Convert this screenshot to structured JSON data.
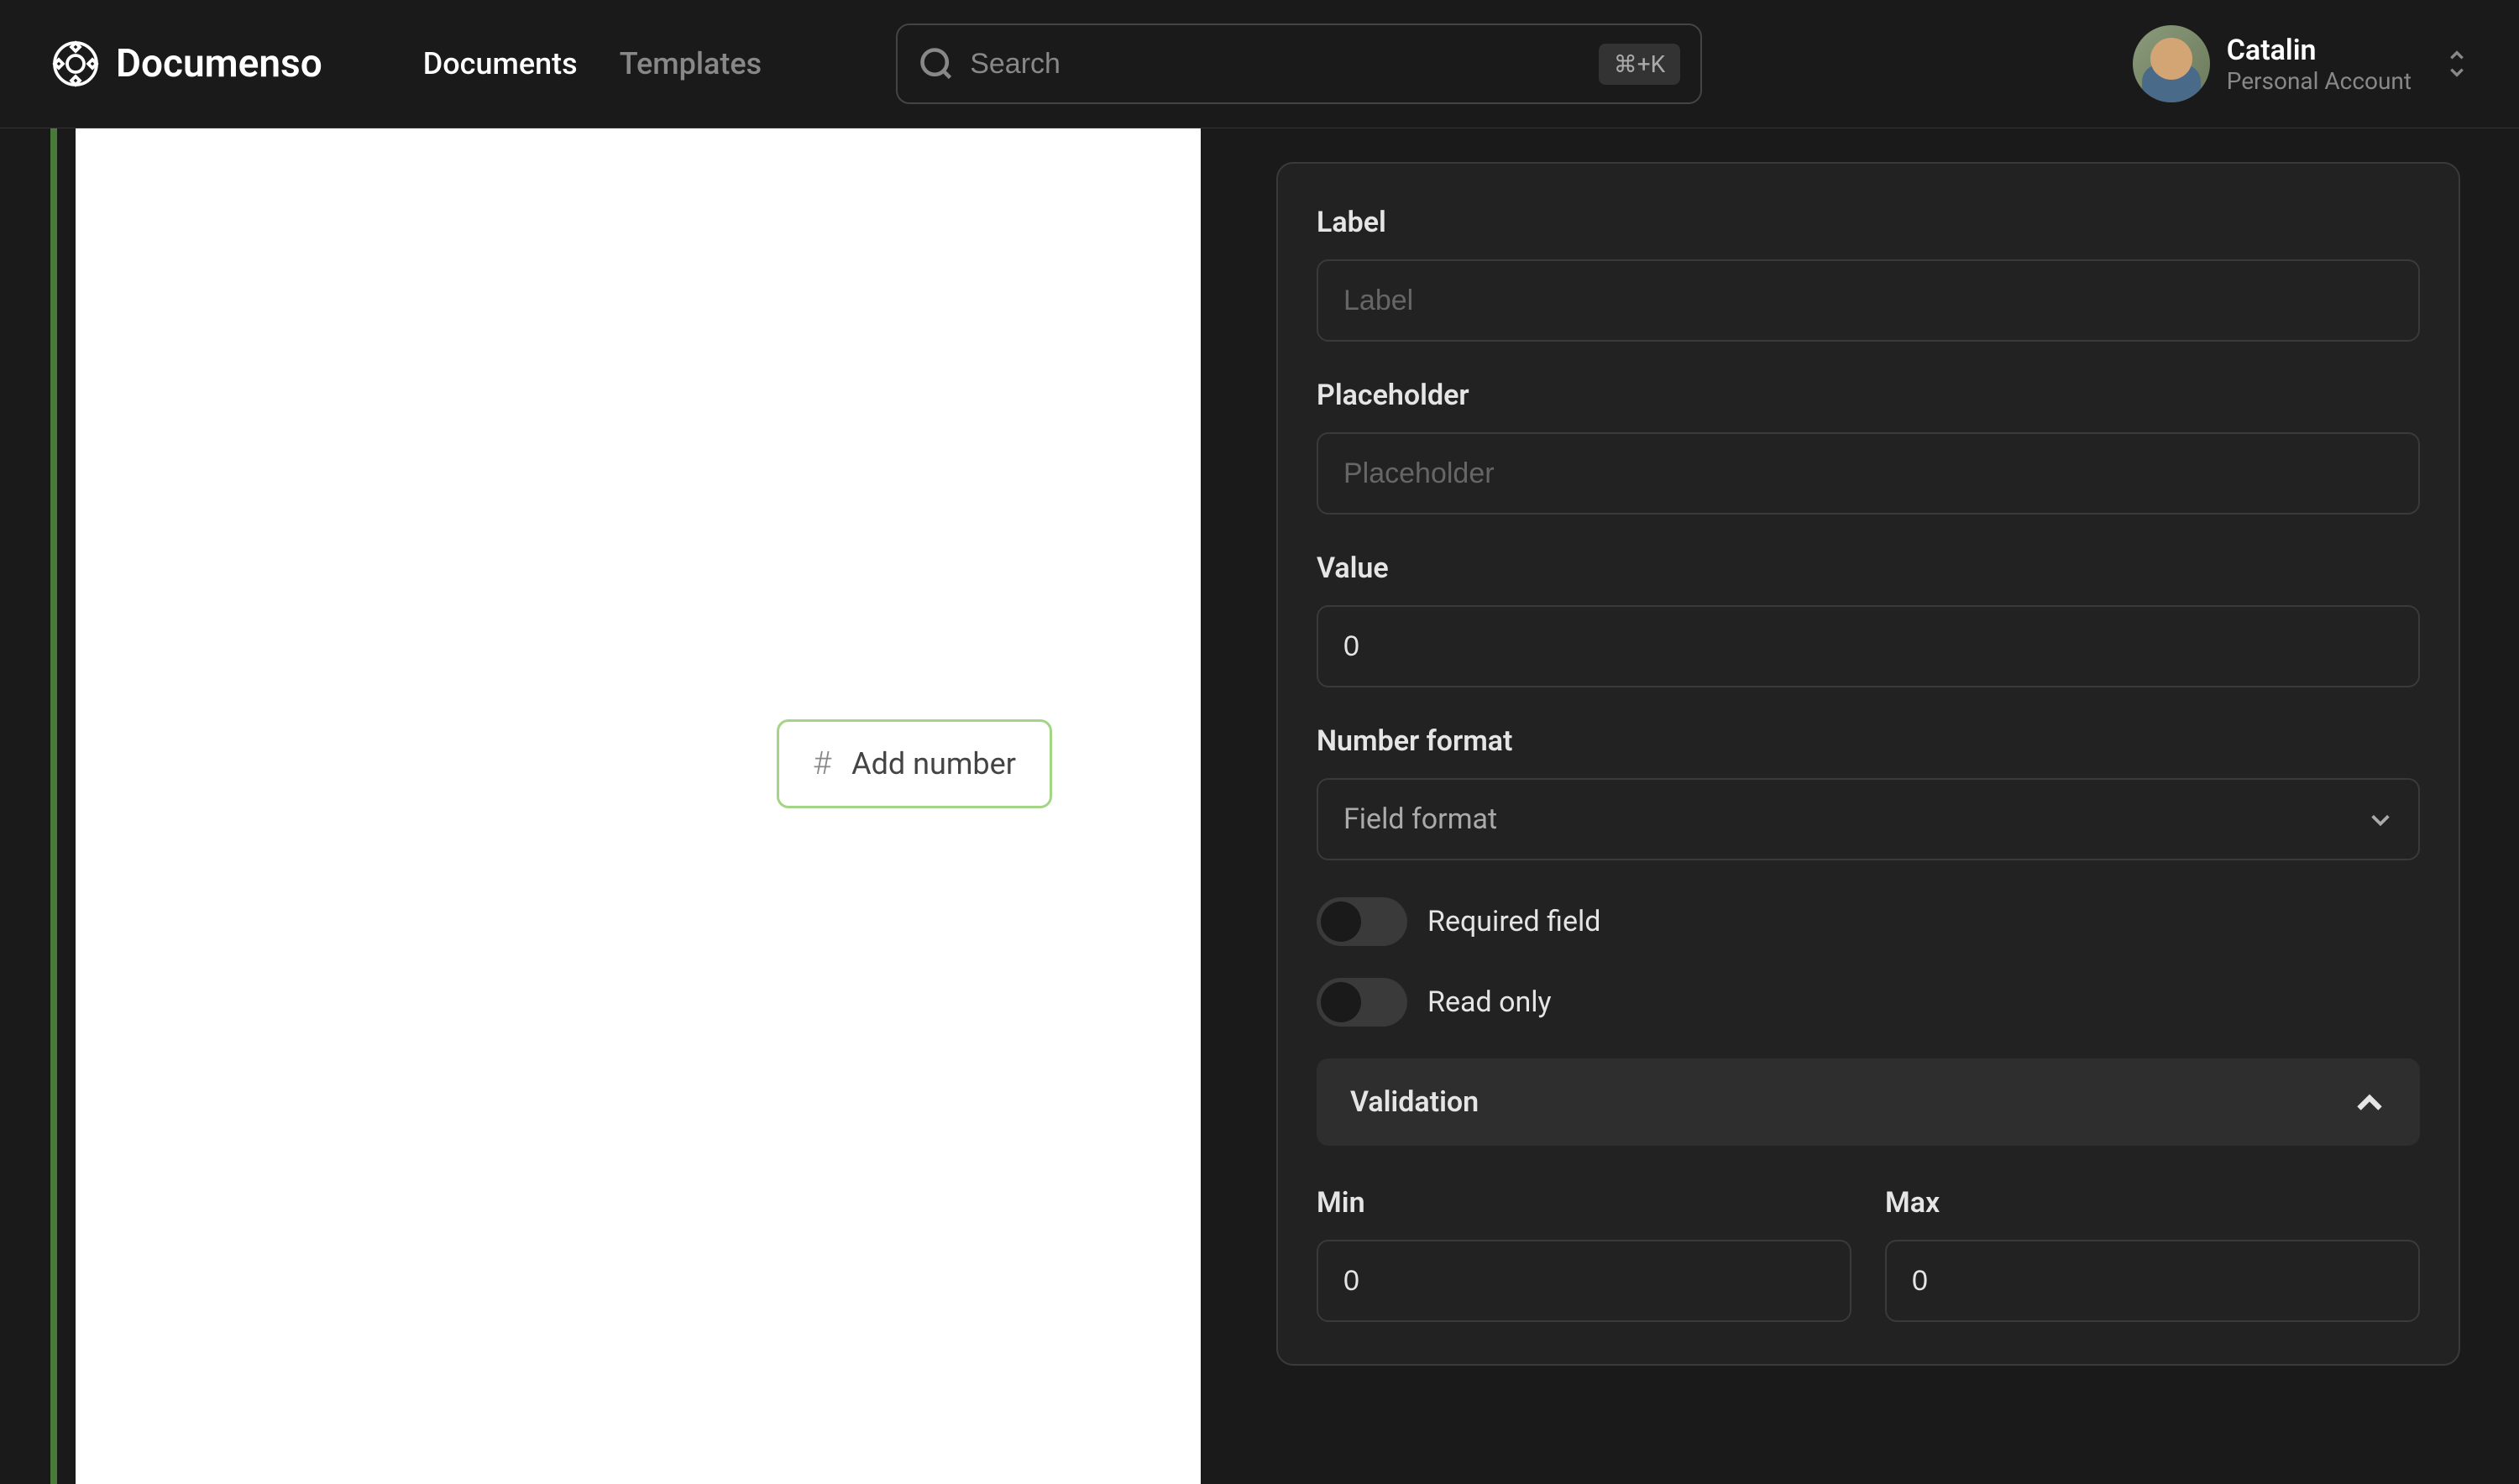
{
  "header": {
    "logo_text": "Documenso",
    "nav": {
      "documents": "Documents",
      "templates": "Templates"
    },
    "search": {
      "placeholder": "Search",
      "shortcut": "⌘+K"
    },
    "user": {
      "name": "Catalin",
      "account": "Personal Account"
    }
  },
  "document": {
    "field_chip": "Add number"
  },
  "panel": {
    "label": {
      "title": "Label",
      "placeholder": "Label",
      "value": ""
    },
    "placeholder": {
      "title": "Placeholder",
      "placeholder": "Placeholder",
      "value": ""
    },
    "value": {
      "title": "Value",
      "value": "0"
    },
    "number_format": {
      "title": "Number format",
      "selected": "Field format"
    },
    "required_field": "Required field",
    "read_only": "Read only",
    "validation": {
      "title": "Validation",
      "min_label": "Min",
      "min_value": "0",
      "max_label": "Max",
      "max_value": "0"
    }
  }
}
